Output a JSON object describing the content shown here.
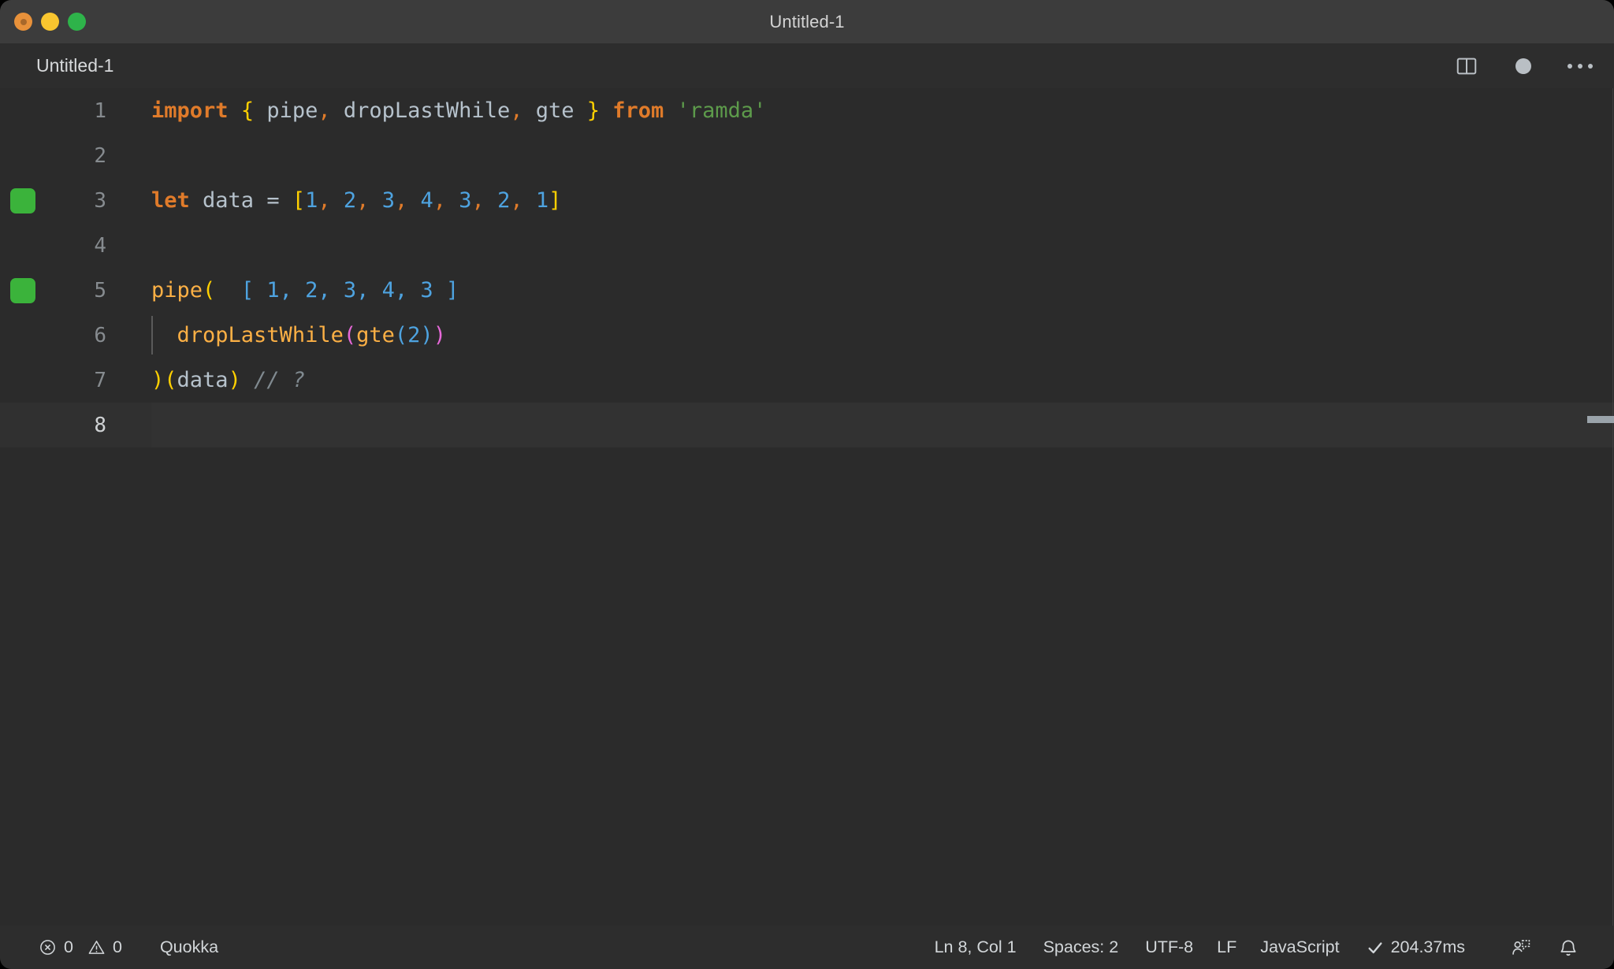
{
  "window": {
    "title": "Untitled-1",
    "traffic_lights": [
      "close-button",
      "minimize-button",
      "maximize-button"
    ]
  },
  "tabbar": {
    "tab_label": "Untitled-1",
    "actions": {
      "split_editor": "split-editor-icon",
      "unsaved_indicator": "unsaved-dot-icon",
      "more_actions": "ellipsis-icon"
    }
  },
  "editor": {
    "language": "JavaScript",
    "lines": [
      {
        "number": "1",
        "marker": null,
        "current": false,
        "indent_guide": false,
        "tokens": [
          {
            "text": "import",
            "cls": "t-kw"
          },
          {
            "text": " ",
            "cls": "t-plain"
          },
          {
            "text": "{",
            "cls": "t-brace-y"
          },
          {
            "text": " pipe",
            "cls": "t-plain"
          },
          {
            "text": ",",
            "cls": "t-comma"
          },
          {
            "text": " dropLastWhile",
            "cls": "t-plain"
          },
          {
            "text": ",",
            "cls": "t-comma"
          },
          {
            "text": " gte ",
            "cls": "t-plain"
          },
          {
            "text": "}",
            "cls": "t-brace-y"
          },
          {
            "text": " ",
            "cls": "t-plain"
          },
          {
            "text": "from",
            "cls": "t-kw"
          },
          {
            "text": " ",
            "cls": "t-plain"
          },
          {
            "text": "'ramda'",
            "cls": "t-str"
          }
        ]
      },
      {
        "number": "2",
        "marker": null,
        "current": false,
        "indent_guide": false,
        "tokens": []
      },
      {
        "number": "3",
        "marker": "#3bb33b",
        "current": false,
        "indent_guide": false,
        "tokens": [
          {
            "text": "let",
            "cls": "t-kw"
          },
          {
            "text": " data = ",
            "cls": "t-plain"
          },
          {
            "text": "[",
            "cls": "t-brace-y"
          },
          {
            "text": "1",
            "cls": "t-num"
          },
          {
            "text": ",",
            "cls": "t-comma"
          },
          {
            "text": " ",
            "cls": "t-plain"
          },
          {
            "text": "2",
            "cls": "t-num"
          },
          {
            "text": ",",
            "cls": "t-comma"
          },
          {
            "text": " ",
            "cls": "t-plain"
          },
          {
            "text": "3",
            "cls": "t-num"
          },
          {
            "text": ",",
            "cls": "t-comma"
          },
          {
            "text": " ",
            "cls": "t-plain"
          },
          {
            "text": "4",
            "cls": "t-num"
          },
          {
            "text": ",",
            "cls": "t-comma"
          },
          {
            "text": " ",
            "cls": "t-plain"
          },
          {
            "text": "3",
            "cls": "t-num"
          },
          {
            "text": ",",
            "cls": "t-comma"
          },
          {
            "text": " ",
            "cls": "t-plain"
          },
          {
            "text": "2",
            "cls": "t-num"
          },
          {
            "text": ",",
            "cls": "t-comma"
          },
          {
            "text": " ",
            "cls": "t-plain"
          },
          {
            "text": "1",
            "cls": "t-num"
          },
          {
            "text": "]",
            "cls": "t-brace-y"
          }
        ]
      },
      {
        "number": "4",
        "marker": null,
        "current": false,
        "indent_guide": false,
        "tokens": []
      },
      {
        "number": "5",
        "marker": "#3bb33b",
        "current": false,
        "indent_guide": false,
        "tokens": [
          {
            "text": "pipe",
            "cls": "t-fn"
          },
          {
            "text": "(",
            "cls": "t-paren-y"
          },
          {
            "text": "  ",
            "cls": "t-plain"
          },
          {
            "text": "[ 1, 2, 3, 4, 3 ]",
            "cls": "t-inline"
          }
        ]
      },
      {
        "number": "6",
        "marker": null,
        "current": false,
        "indent_guide": true,
        "tokens": [
          {
            "text": "  ",
            "cls": "t-plain"
          },
          {
            "text": "dropLastWhile",
            "cls": "t-fn"
          },
          {
            "text": "(",
            "cls": "t-paren-m"
          },
          {
            "text": "gte",
            "cls": "t-fn"
          },
          {
            "text": "(",
            "cls": "t-paren-b"
          },
          {
            "text": "2",
            "cls": "t-num"
          },
          {
            "text": ")",
            "cls": "t-paren-b"
          },
          {
            "text": ")",
            "cls": "t-paren-m"
          }
        ]
      },
      {
        "number": "7",
        "marker": null,
        "current": false,
        "indent_guide": false,
        "tokens": [
          {
            "text": ")",
            "cls": "t-paren-y"
          },
          {
            "text": "(",
            "cls": "t-paren-y"
          },
          {
            "text": "data",
            "cls": "t-plain"
          },
          {
            "text": ")",
            "cls": "t-paren-y"
          },
          {
            "text": " ",
            "cls": "t-plain"
          },
          {
            "text": "// ?",
            "cls": "t-comment"
          }
        ]
      },
      {
        "number": "8",
        "marker": null,
        "current": true,
        "indent_guide": false,
        "tokens": []
      }
    ]
  },
  "statusbar": {
    "errors_icon": "error-circle-icon",
    "errors_count": "0",
    "warnings_icon": "warning-triangle-icon",
    "warnings_count": "0",
    "quokka_label": "Quokka",
    "cursor_position": "Ln 8, Col 1",
    "indentation": "Spaces: 2",
    "encoding": "UTF-8",
    "eol": "LF",
    "language_mode": "JavaScript",
    "run_status_icon": "checkmark-icon",
    "run_time": "204.37ms",
    "feedback_icon": "feedback-person-icon",
    "bell_icon": "bell-icon"
  },
  "colors": {
    "titlebar_bg": "#3c3c3c",
    "tabbar_bg": "#2d2d2d",
    "editor_bg": "#2b2b2b",
    "statusbar_bg": "#2d2d2d",
    "gutter_marker_green": "#3bb33b",
    "keyword_orange": "#e07b2a",
    "string_green": "#5d9b4b",
    "number_blue": "#4ea3e0",
    "function_yellow": "#fcb045",
    "bracket_yellow": "#ffd000",
    "bracket_magenta": "#e668d8"
  }
}
